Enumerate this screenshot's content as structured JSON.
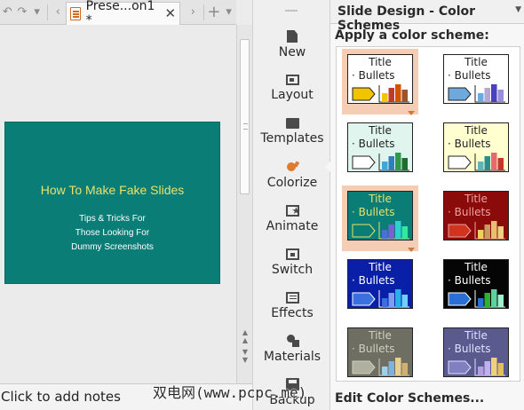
{
  "tab": {
    "title": "Prese...on1 *",
    "close": "✕"
  },
  "tabbar_icons": {
    "back": "↶",
    "forward": "↷",
    "more": "▾",
    "prev_tab": "‹",
    "next_tab": "›",
    "add_tab": "+",
    "menu": "▾"
  },
  "slide": {
    "title": "How To Make Fake Slides",
    "subtitle_lines": [
      "Tips & Tricks For",
      "Those Looking For",
      "Dummy Screenshots"
    ],
    "background": "#0b7d77",
    "title_color": "#e7e26a"
  },
  "notes": {
    "placeholder": "Click to add notes"
  },
  "toolstrip": {
    "items": [
      {
        "label": "New",
        "icon": "new-page-icon"
      },
      {
        "label": "Layout",
        "icon": "layout-icon"
      },
      {
        "label": "Templates",
        "icon": "templates-icon"
      },
      {
        "label": "Colorize",
        "icon": "colorize-icon"
      },
      {
        "label": "Animate",
        "icon": "animate-icon"
      },
      {
        "label": "Switch",
        "icon": "switch-icon"
      },
      {
        "label": "Effects",
        "icon": "effects-icon"
      },
      {
        "label": "Materials",
        "icon": "materials-icon"
      },
      {
        "label": "Backup",
        "icon": "backup-icon"
      }
    ]
  },
  "panel": {
    "title": "Slide Design - Color Schemes",
    "apply_label": "Apply a color scheme:",
    "edit_link": "Edit Color Schemes...",
    "thumb_title": "Title",
    "thumb_bullets": "· Bullets",
    "schemes": [
      {
        "bg": "#ffffff",
        "title": "#222222",
        "arrow": "#f2c400",
        "bars": [
          "#f2c400",
          "#c0392b",
          "#d35400",
          "#a0522d"
        ],
        "selected": true
      },
      {
        "bg": "#ffffff",
        "title": "#222222",
        "arrow": "#6fa8dc",
        "bars": [
          "#6fa8dc",
          "#b4a7d6",
          "#4a3fbf",
          "#9b8ed9"
        ],
        "selected": false
      },
      {
        "bg": "#e0f5ee",
        "title": "#222222",
        "arrow": "#ffffff",
        "bars": [
          "#3fa9d6",
          "#2f7fbf",
          "#2e9a4a",
          "#1d6e2f"
        ],
        "selected": false
      },
      {
        "bg": "#ffffd0",
        "title": "#222222",
        "arrow": "#ffffff",
        "bars": [
          "#5fb4b4",
          "#2c8d8d",
          "#e56b6f",
          "#c0392b"
        ],
        "selected": false
      },
      {
        "bg": "#0b7d77",
        "title": "#e7e26a",
        "arrow": "#0b7d77",
        "bars": [
          "#4a6fd6",
          "#7b5fd6",
          "#2fd0d0",
          "#30e8a0"
        ],
        "selected": true
      },
      {
        "bg": "#8b0b0b",
        "title": "#f0a0a0",
        "arrow": "#d0341f",
        "bars": [
          "#f0d060",
          "#c89a60",
          "#e8c070",
          "#f0d080"
        ],
        "selected": false
      },
      {
        "bg": "#0a1fa8",
        "title": "#ffffff",
        "arrow": "#3a6fe0",
        "bars": [
          "#3a6fe0",
          "#7a9ff0",
          "#2ab0e8",
          "#70d0f8"
        ],
        "selected": false
      },
      {
        "bg": "#050505",
        "title": "#ffffff",
        "arrow": "#2b6fd6",
        "bars": [
          "#2b6fd6",
          "#30b030",
          "#5fd0a0",
          "#a0f0d0"
        ],
        "selected": false
      },
      {
        "bg": "#6e6e62",
        "title": "#d0d0c0",
        "arrow": "#b0b0a0",
        "bars": [
          "#9fd0e8",
          "#7fb0e0",
          "#e8d090",
          "#d0b070"
        ],
        "selected": false
      },
      {
        "bg": "#5a5a8e",
        "title": "#e0e0ff",
        "arrow": "#8080c0",
        "bars": [
          "#b0a0e0",
          "#c0b0f0",
          "#f0d080",
          "#e0c060"
        ],
        "selected": false
      }
    ]
  },
  "watermark": "双电网(www.pcpc.me)"
}
